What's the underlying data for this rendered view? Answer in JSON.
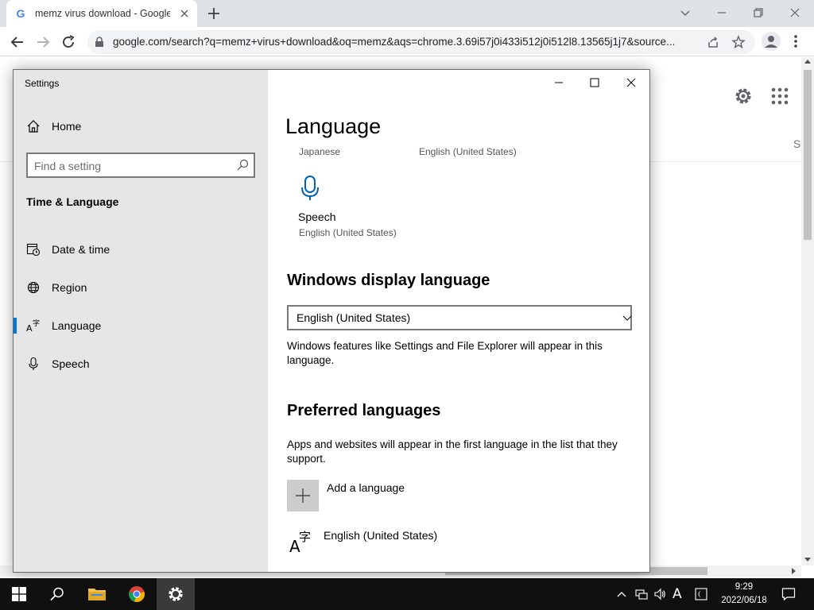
{
  "browser": {
    "tab_title": "memz virus download - Google S",
    "url": "google.com/search?q=memz+virus+download&oq=memz&aqs=chrome.3.69i57j0i433i512j0i512l8.13565j1j7&source..."
  },
  "google": {
    "partial_tab_letter": "S"
  },
  "settings": {
    "window_title": "Settings",
    "home_label": "Home",
    "search_placeholder": "Find a setting",
    "section_title": "Time & Language",
    "nav": [
      {
        "label": "Date & time",
        "icon": "calendar-clock-icon"
      },
      {
        "label": "Region",
        "icon": "globe-icon"
      },
      {
        "label": "Language",
        "icon": "language-icon"
      },
      {
        "label": "Speech",
        "icon": "microphone-icon"
      }
    ],
    "selected_nav": "Language",
    "page_title": "Language",
    "cut_row": {
      "left": "Japanese",
      "right": "English (United States)"
    },
    "speech_tile": {
      "label": "Speech",
      "sublabel": "English (United States)"
    },
    "display_language": {
      "heading": "Windows display language",
      "selected": "English (United States)",
      "description": "Windows features like Settings and File Explorer will appear in this language."
    },
    "preferred": {
      "heading": "Preferred languages",
      "description": "Apps and websites will appear in the first language in the list that they support.",
      "add_label": "Add a language",
      "languages": [
        "English (United States)"
      ]
    }
  },
  "taskbar": {
    "ime_letter": "A",
    "time": "9:29",
    "date": "2022/06/18"
  },
  "colors": {
    "accent": "#0078d7",
    "sidebar_bg": "#e6e6e6",
    "taskbar_bg": "#101010",
    "chrome_tabbar": "#dee1e6"
  }
}
